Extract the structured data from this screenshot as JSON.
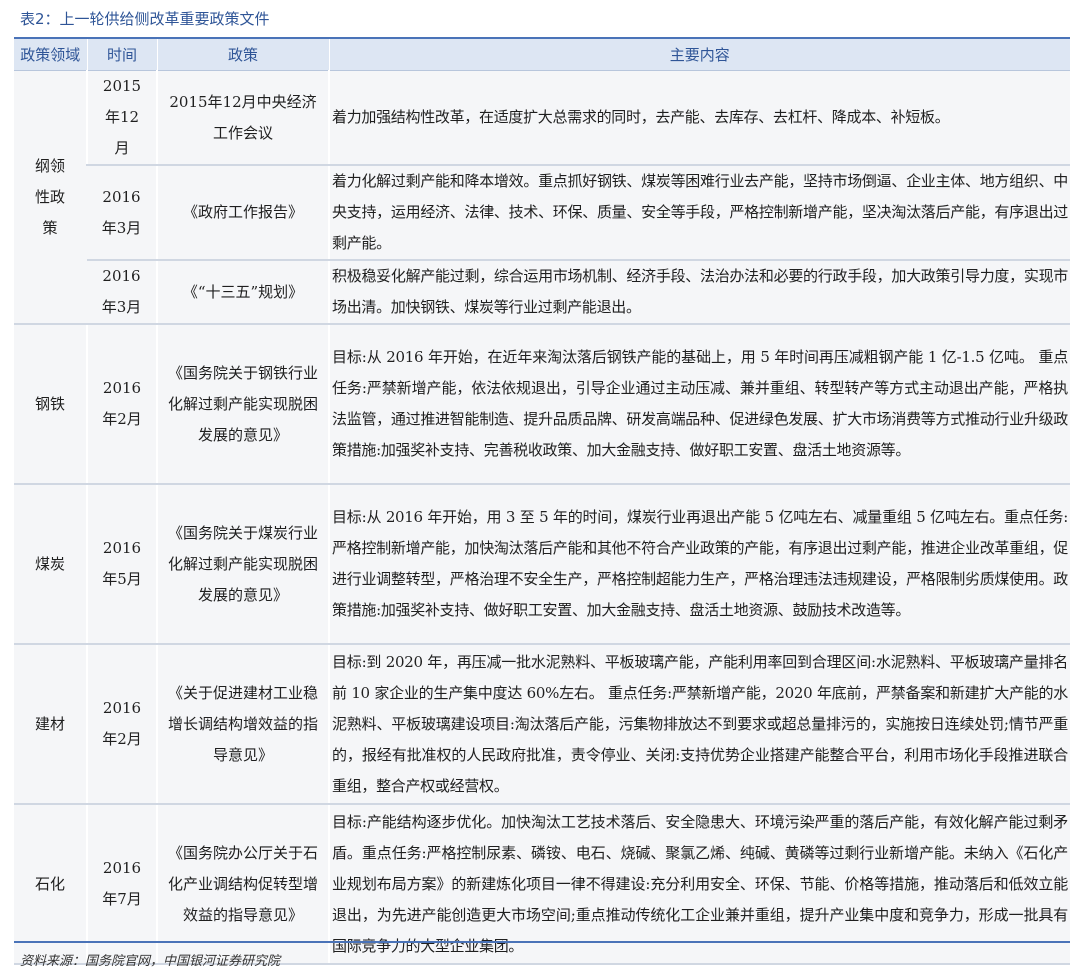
{
  "caption": "表2：上一轮供给侧改革重要政策文件",
  "headers": [
    "政策领域",
    "时间",
    "政策",
    "主要内容"
  ],
  "rows": [
    {
      "domain": "纲领性政策",
      "time": "2015年12月",
      "policy": "2015年12月中央经济工作会议",
      "content": "着力加强结构性改革，在适度扩大总需求的同时，去产能、去库存、去杠杆、降成本、补短板。"
    },
    {
      "domain": "",
      "time": "2016年3月",
      "policy": "《政府工作报告》",
      "content": "着力化解过剩产能和降本增效。重点抓好钢铁、煤炭等困难行业去产能，坚持市场倒逼、企业主体、地方组织、中央支持，运用经济、法律、技术、环保、质量、安全等手段，严格控制新增产能，坚决淘汰落后产能，有序退出过剩产能。"
    },
    {
      "domain": "",
      "time": "2016年3月",
      "policy": "《“十三五”规划》",
      "content": "积极稳妥化解产能过剩，综合运用市场机制、经济手段、法治办法和必要的行政手段，加大政策引导力度，实现市场出清。加快钢铁、煤炭等行业过剩产能退出。"
    },
    {
      "domain": "钢铁",
      "time": "2016年2月",
      "policy": "《国务院关于钢铁行业化解过剩产能实现脱困发展的意见》",
      "content": "目标:从 2016 年开始，在近年来淘汰落后钢铁产能的基础上，用 5 年时间再压减粗钢产能 1 亿-1.5 亿吨。 重点任务:严禁新增产能，依法依规退出，引导企业通过主动压减、兼并重组、转型转产等方式主动退出产能，严格执法监管，通过推进智能制造、提升品质品牌、研发高端品种、促进绿色发展、扩大市场消费等方式推动行业升级政策措施:加强奖补支持、完善税收政策、加大金融支持、做好职工安置、盘活土地资源等。"
    },
    {
      "domain": "煤炭",
      "time": "2016年5月",
      "policy": "《国务院关于煤炭行业化解过剩产能实现脱困发展的意见》",
      "content": "目标:从 2016 年开始，用 3 至 5 年的时间，煤炭行业再退出产能 5 亿吨左右、减量重组 5 亿吨左右。重点任务:严格控制新增产能，加快淘汰落后产能和其他不符合产业政策的产能，有序退出过剩产能，推进企业改革重组，促进行业调整转型，严格治理不安全生产，严格控制超能力生产，严格治理违法违规建设，严格限制劣质煤使用。政策措施:加强奖补支持、做好职工安置、加大金融支持、盘活土地资源、鼓励技术改造等。"
    },
    {
      "domain": "建材",
      "time": "2016年2月",
      "policy": "《关于促进建材工业稳增长调结构增效益的指导意见》",
      "content": "目标:到 2020 年，再压减一批水泥熟料、平板玻璃产能，产能利用率回到合理区间:水泥熟料、平板玻璃产量排名前 10 家企业的生产集中度达 60%左右。 重点任务:严禁新增产能，2020 年底前，严禁备案和新建扩大产能的水泥熟料、平板玻璃建设项目:淘汰落后产能，污集物排放达不到要求或超总量排污的，实施按日连续处罚;情节严重的，报经有批准权的人民政府批准，责令停业、关闭:支持优势企业搭建产能整合平台，利用市场化手段推进联合重组，整合产权或经营权。"
    },
    {
      "domain": "石化",
      "time": "2016年7月",
      "policy": "《国务院办公厅关于石化产业调结构促转型增效益的指导意见》",
      "content": "目标:产能结构逐步优化。加快淘汰工艺技术落后、安全隐患大、环境污染严重的落后产能，有效化解产能过剩矛盾。重点任务:严格控制尿素、磷铵、电石、烧碱、聚氯乙烯、纯碱、黄磷等过剩行业新增产能。未纳入《石化产业规划布局方案》的新建炼化项目一律不得建设:充分利用安全、环保、节能、价格等措施，推动落后和低效立能退出，为先进产能创造更大市场空间;重点推动传统化工企业兼并重组，提升产业集中度和竞争力，形成一批具有国际竞争力的大型企业集团。"
    }
  ],
  "source": "资料来源：国务院官网，中国银河证券研究院"
}
